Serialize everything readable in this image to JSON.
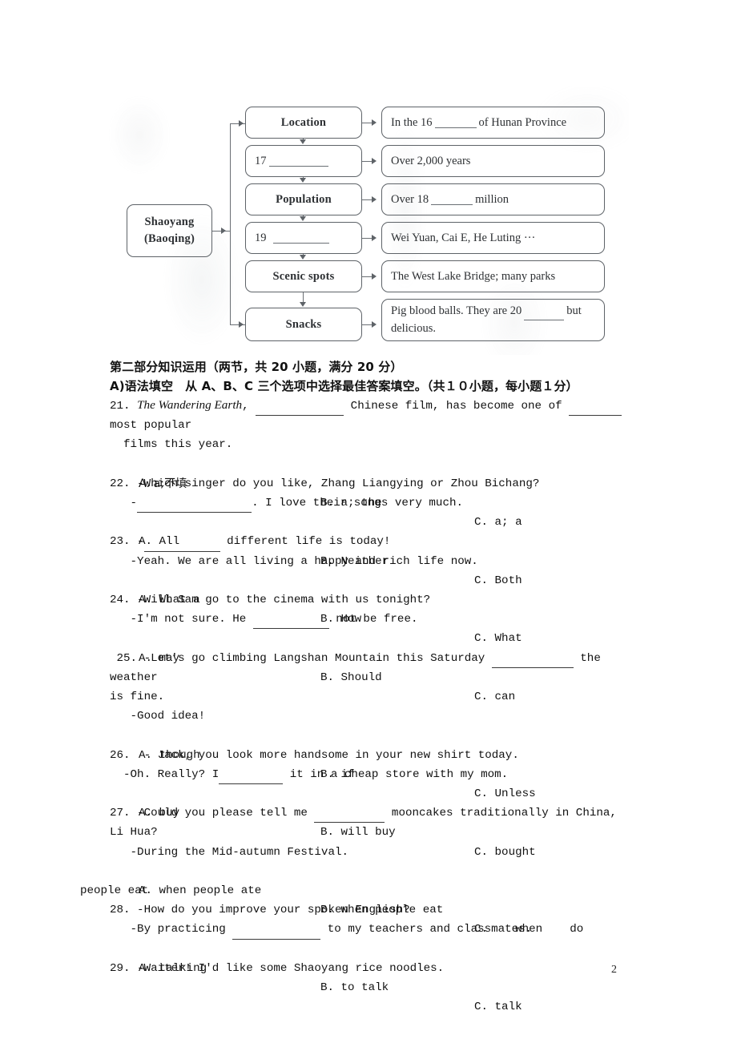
{
  "page": {
    "number": "2"
  },
  "flowchart": {
    "root": {
      "line1": "Shaoyang",
      "line2": "(Baoqing)"
    },
    "categories": [
      {
        "label": "Location",
        "blank": ""
      },
      {
        "label": "17",
        "blank": "______"
      },
      {
        "label": "Population",
        "blank": ""
      },
      {
        "label": "19",
        "blank": "______"
      },
      {
        "label": "Scenic spots",
        "blank": ""
      },
      {
        "label": "Snacks",
        "blank": ""
      }
    ],
    "details": [
      {
        "pre": "In the 16",
        "post": "of Hunan Province",
        "has_blank": true
      },
      {
        "pre": "Over 2,000 years",
        "post": "",
        "has_blank": false
      },
      {
        "pre": "Over 18",
        "post": "million",
        "has_blank": true
      },
      {
        "pre": "Wei Yuan, Cai E, He Luting  ···",
        "post": "",
        "has_blank": false
      },
      {
        "pre": "The West Lake Bridge; many parks",
        "post": "",
        "has_blank": false
      },
      {
        "pre": "Pig blood balls. They are 20",
        "post": "but delicious.",
        "has_blank": true
      }
    ]
  },
  "headings": {
    "part_two": "第二部分知识运用（两节，共 20 小题，满分 20 分）",
    "section_a": "A)语法填空　从 A、B、C 三个选项中选择最佳答案填空。（共１０小题，每小题１分）"
  },
  "questions": [
    {
      "number": "21.",
      "stem_pre": "21. ",
      "italic": "The Wandering Earth",
      "stem_a": ", ",
      "stem_b": " Chinese film, has become one of ",
      "stem_c": "most popular",
      "line2": "  films this year.",
      "options": {
        "a": "A. a;不填",
        "b": "B. a; the",
        "c": "C. a; a"
      }
    },
    {
      "number": "22.",
      "line1": "22. -Which singer do you like, Zhang Liangying or Zhou Bichang?",
      "line2_pre": "   -",
      "line2_post": ". I love their songs very much.",
      "options": {
        "a": "A. All",
        "b": "B. Neither",
        "c": "C. Both"
      }
    },
    {
      "number": "23.",
      "line1_pre": "23. -",
      "line1_post": " different life is today!",
      "line2": "   -Yeah. We are all living a happy and rich life now.",
      "options": {
        "a": "A. What a",
        "b": "B. How",
        "c": "C. What"
      }
    },
    {
      "number": "24.",
      "line1": "24. -Will Sam go to the cinema with us tonight?",
      "line2_pre": "   -I'm not sure. He ",
      "line2_post": " not be free.",
      "options": {
        "a": "A. may",
        "b": "B. Should",
        "c": "C. can"
      }
    },
    {
      "number": "25.",
      "line1_pre": " 25. -Let's go climbing Langshan Mountain this Saturday ",
      "line1_post": " the weather",
      "line2": "is fine.",
      "line3": "   -Good idea!",
      "options": {
        "a": "A. though",
        "b": "B. if",
        "c": "C. Unless"
      }
    },
    {
      "number": "26.",
      "line1": "26.  - Jack, you look more handsome in your new shirt today.",
      "line2_pre": "  -Oh. Really? I",
      "line2_post": " it in a cheap store with my mom.",
      "options": {
        "a": "A. buy",
        "b": "B. will buy",
        "c": "C. bought"
      }
    },
    {
      "number": "27.",
      "line1_pre": "27. -Could you please tell me ",
      "line1_post": " mooncakes traditionally in China, Li Hua?",
      "line2": "   -During the Mid-autumn Festival.",
      "options": {
        "a": "A. when people ate",
        "b": "B. when people eat",
        "c": "C.    when    do"
      },
      "options_overflow": "people eat"
    },
    {
      "number": "28.",
      "line1": "28. -How do you improve your spoken English?",
      "line2_pre": "   -By practicing ",
      "line2_post": " to my teachers and classmates.",
      "options": {
        "a": "A. talking",
        "b": "B. to talk",
        "c": "C. talk"
      }
    },
    {
      "number": "29.",
      "line1": "29. -Waiter! I'd like some Shaoyang rice noodles."
    }
  ]
}
